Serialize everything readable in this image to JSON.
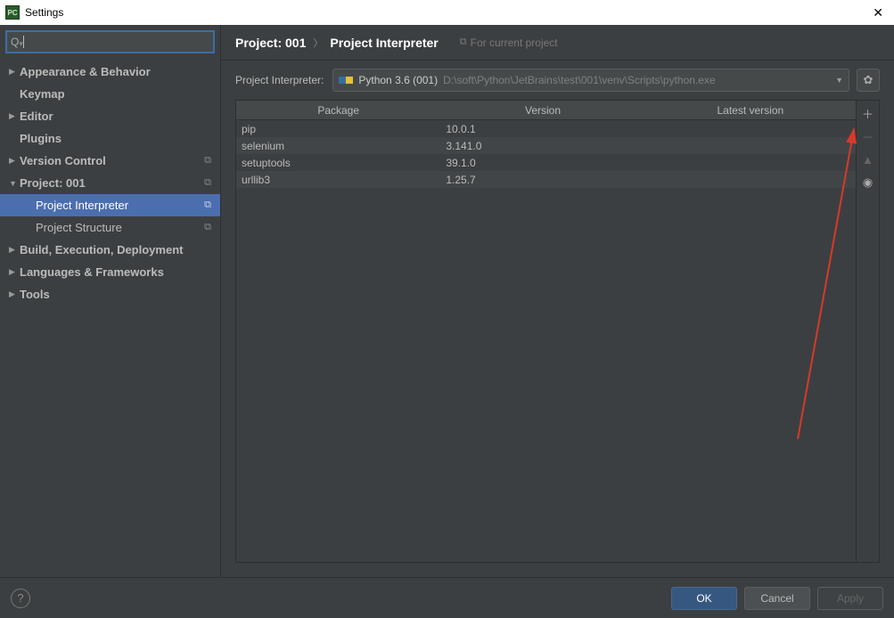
{
  "window": {
    "title": "Settings"
  },
  "sidebar": {
    "search_placeholder": "",
    "items": [
      {
        "label": "Appearance & Behavior",
        "arrow": "▶",
        "bold": true
      },
      {
        "label": "Keymap",
        "arrow": "",
        "bold": true
      },
      {
        "label": "Editor",
        "arrow": "▶",
        "bold": true
      },
      {
        "label": "Plugins",
        "arrow": "",
        "bold": true
      },
      {
        "label": "Version Control",
        "arrow": "▶",
        "bold": true,
        "copy": true
      },
      {
        "label": "Project: 001",
        "arrow": "▼",
        "bold": true,
        "copy": true
      },
      {
        "label": "Project Interpreter",
        "arrow": "",
        "indent": true,
        "selected": true,
        "copy": true
      },
      {
        "label": "Project Structure",
        "arrow": "",
        "indent": true,
        "copy": true
      },
      {
        "label": "Build, Execution, Deployment",
        "arrow": "▶",
        "bold": true
      },
      {
        "label": "Languages & Frameworks",
        "arrow": "▶",
        "bold": true
      },
      {
        "label": "Tools",
        "arrow": "▶",
        "bold": true
      }
    ]
  },
  "breadcrumb": {
    "project": "Project: 001",
    "page": "Project Interpreter",
    "hint": "For current project"
  },
  "interpreter": {
    "label": "Project Interpreter:",
    "name": "Python 3.6 (001)",
    "path": "D:\\soft\\Python\\JetBrains\\test\\001\\venv\\Scripts\\python.exe"
  },
  "packages": {
    "headers": {
      "pkg": "Package",
      "ver": "Version",
      "lat": "Latest version"
    },
    "rows": [
      {
        "pkg": "pip",
        "ver": "10.0.1",
        "lat": ""
      },
      {
        "pkg": "selenium",
        "ver": "3.141.0",
        "lat": ""
      },
      {
        "pkg": "setuptools",
        "ver": "39.1.0",
        "lat": ""
      },
      {
        "pkg": "urllib3",
        "ver": "1.25.7",
        "lat": ""
      }
    ]
  },
  "footer": {
    "ok": "OK",
    "cancel": "Cancel",
    "apply": "Apply"
  }
}
